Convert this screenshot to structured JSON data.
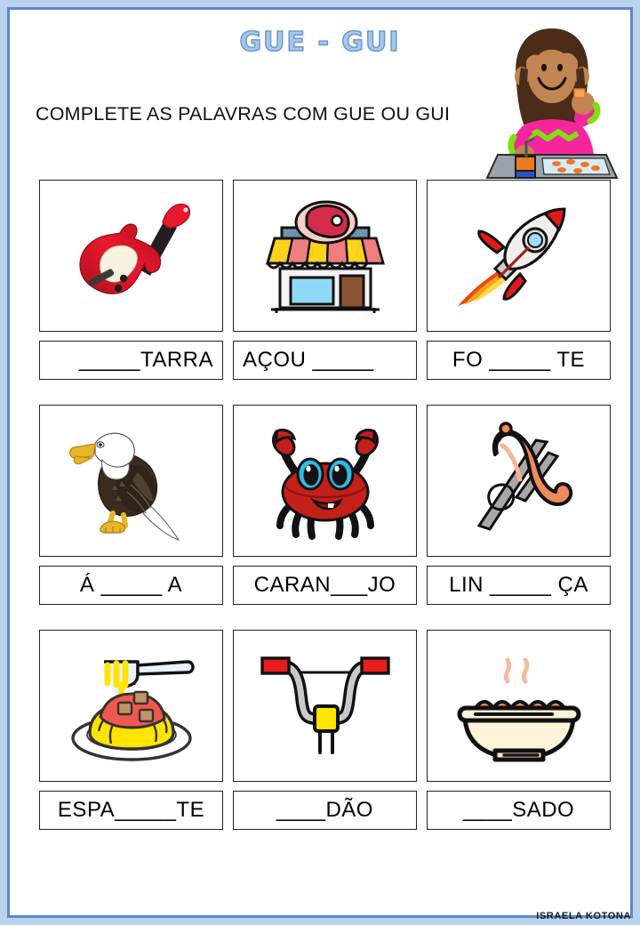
{
  "worksheet": {
    "title": "GUE - GUI",
    "instruction": "COMPLETE AS PALAVRAS COM GUE OU GUI",
    "credit": "ISRAELA KOTONA",
    "title_color": "#a9c6e8",
    "border_color": "#5b8ac8",
    "border_fill": "#b9d2ee"
  },
  "header_image": {
    "name": "girl-eating-lunch",
    "skin": "#c08552",
    "hair": "#4a2c18",
    "shirt": "#f5269b",
    "shirt_accent": "#7ee00d",
    "tray": "#9aa2aa",
    "juice_box": "#f07820"
  },
  "items": [
    {
      "icon": "electric-guitar-icon",
      "answer_word": "GUITARRA",
      "label": "_____TARRA",
      "align": "right",
      "colors": {
        "body": "#e8192c",
        "body_dark": "#a8101f",
        "neck": "#241f1f",
        "pickguard": "#f7f2dd"
      }
    },
    {
      "icon": "butcher-shop-icon",
      "answer_word": "ACOUGUE",
      "label": "AÇOU _____",
      "align": "left",
      "colors": {
        "awning_yellow": "#ffd21e",
        "awning_red": "#ef7e7e",
        "window": "#8fd8f7",
        "door": "#8a5432",
        "meat": "#d32d4b"
      }
    },
    {
      "icon": "rocket-icon",
      "answer_word": "FOGUETE",
      "label": "FO _____ TE",
      "align": "center",
      "colors": {
        "body": "#eeeeee",
        "fin": "#e01b1b",
        "window": "#9fdcf5",
        "flame": "#f6a31a",
        "flame2": "#ea4a10"
      }
    },
    {
      "icon": "bald-eagle-icon",
      "answer_word": "AGUIA",
      "label": "Á _____ A",
      "align": "center",
      "colors": {
        "body": "#3a2d20",
        "head": "#ffffff",
        "beak": "#e8b52a",
        "feet": "#e8b52a"
      }
    },
    {
      "icon": "crab-icon",
      "answer_word": "CARANGUEJO",
      "label": "CARAN___JO",
      "align": "center",
      "colors": {
        "body": "#c4201a",
        "eye_ring": "#2fb9e8",
        "eye": "#111111",
        "mouth": "#8c1410"
      }
    },
    {
      "icon": "sausage-on-fork-icon",
      "answer_word": "LINGUICA",
      "label": "LIN _____ ÇA",
      "align": "center",
      "colors": {
        "sausage": "#ef8b5a",
        "fork": "#a8a8a8"
      }
    },
    {
      "icon": "spaghetti-icon",
      "answer_word": "ESPAGUETE",
      "label": "ESPA_____TE",
      "align": "center",
      "colors": {
        "noodles": "#ffe400",
        "sauce": "#f2584f",
        "plate": "#ffffff",
        "meat": "#c59263"
      }
    },
    {
      "icon": "bicycle-handlebar-icon",
      "answer_word": "GUIDAO",
      "label": "____DÃO",
      "align": "center",
      "colors": {
        "bar": "#c9c9c9",
        "grip": "#e81c1c",
        "stem": "#ffe400"
      }
    },
    {
      "icon": "soup-bowl-icon",
      "answer_word": "GUISADO",
      "label": "____SADO",
      "align": "center",
      "colors": {
        "bowl": "#fdf3d8",
        "stew": "#f98d52",
        "steam": "#f6bba0"
      }
    }
  ]
}
